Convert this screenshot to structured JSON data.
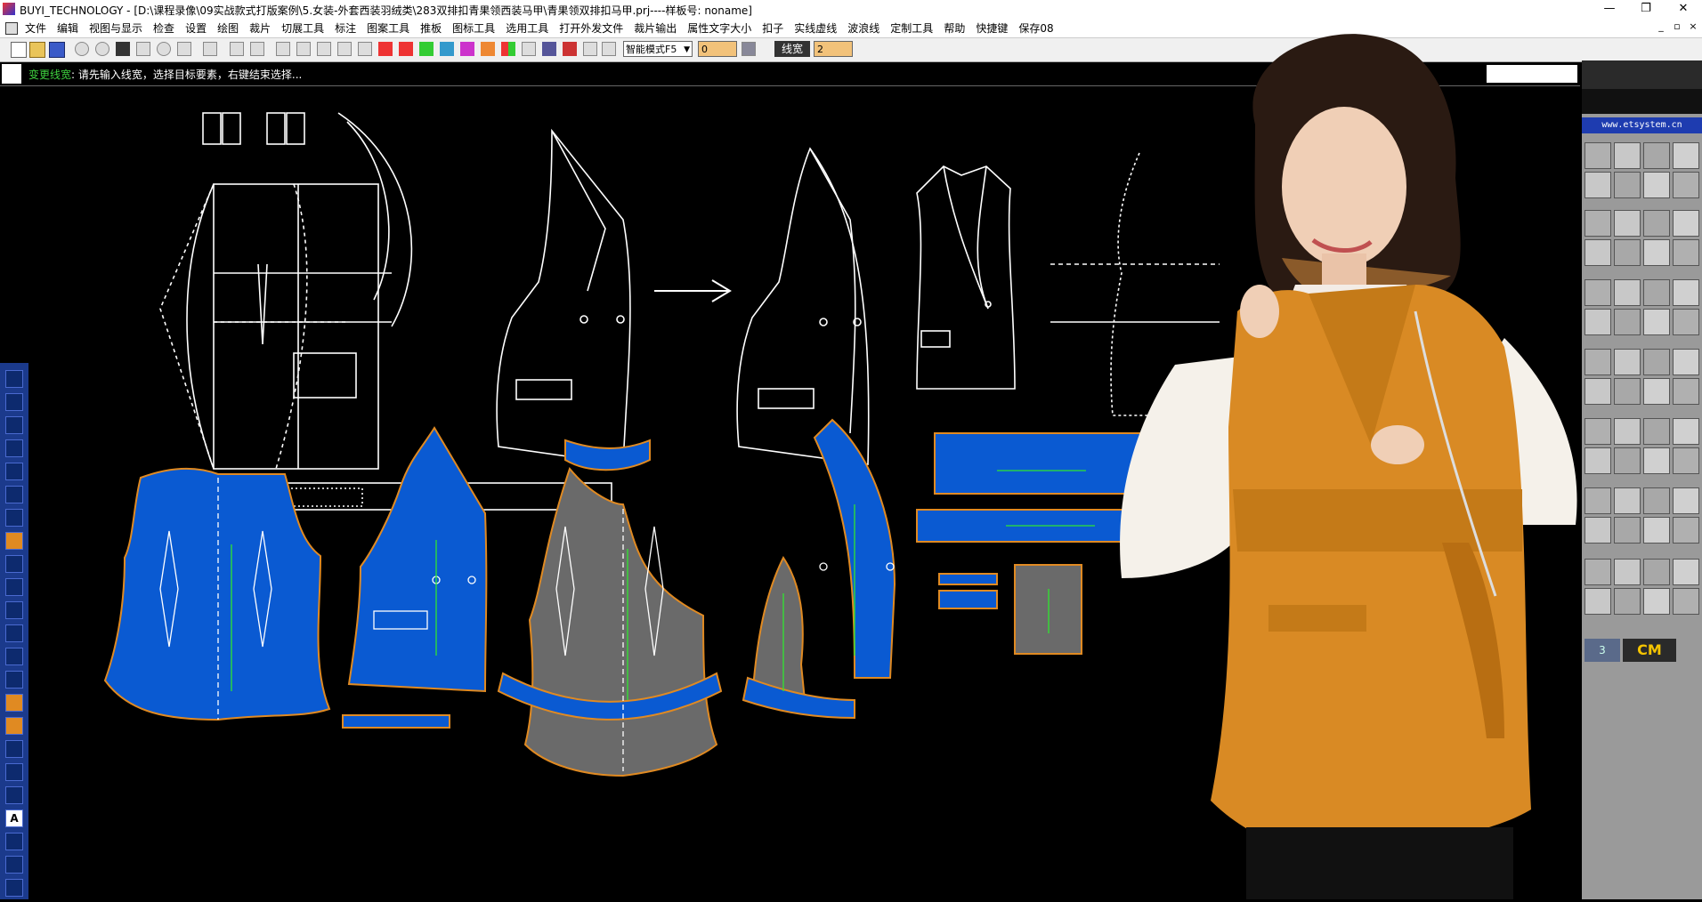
{
  "window": {
    "title": "BUYI_TECHNOLOGY - [D:\\课程录像\\09实战款式打版案例\\5.女装-外套西装羽绒类\\283双排扣青果领西装马甲\\青果领双排扣马甲.prj----样板号: noname]",
    "minimize": "—",
    "restore": "❐",
    "close": "✕"
  },
  "menu": {
    "items": [
      "文件",
      "编辑",
      "视图与显示",
      "检查",
      "设置",
      "绘图",
      "裁片",
      "切展工具",
      "标注",
      "图案工具",
      "推板",
      "图标工具",
      "选用工具",
      "打开外发文件",
      "裁片输出",
      "属性文字大小",
      "扣子",
      "实线虚线",
      "波浪线",
      "定制工具",
      "帮助",
      "快捷键",
      "保存08"
    ]
  },
  "toolbar": {
    "mode_label": "智能模式F5",
    "field_value": "0",
    "lw_label": "线宽",
    "lw_value": "2"
  },
  "status": {
    "command": "变更线宽",
    "prompt": ":  请先输入线宽，选择目标要素，右键结束选择..."
  },
  "right_panel": {
    "url": "www.etsystem.cn",
    "unit_button": "3",
    "unit": "CM"
  },
  "colors": {
    "piece_blue": "#0a5ad2",
    "piece_gray": "#6a6a6a",
    "outline_orange": "#e08a22",
    "orange_vest": "#d98a24"
  },
  "icons": {
    "toolbar": [
      "new-icon",
      "open-icon",
      "save-icon",
      "zoom-out-icon",
      "zoom-in-icon",
      "fit-icon",
      "pan-icon",
      "zoom-window-icon",
      "undo-icon",
      "redo-icon"
    ],
    "left": [
      "arrow-icon",
      "line-icon",
      "curve-icon",
      "rect-icon",
      "grid-icon",
      "circle-icon",
      "text-icon",
      "pen-icon"
    ]
  }
}
